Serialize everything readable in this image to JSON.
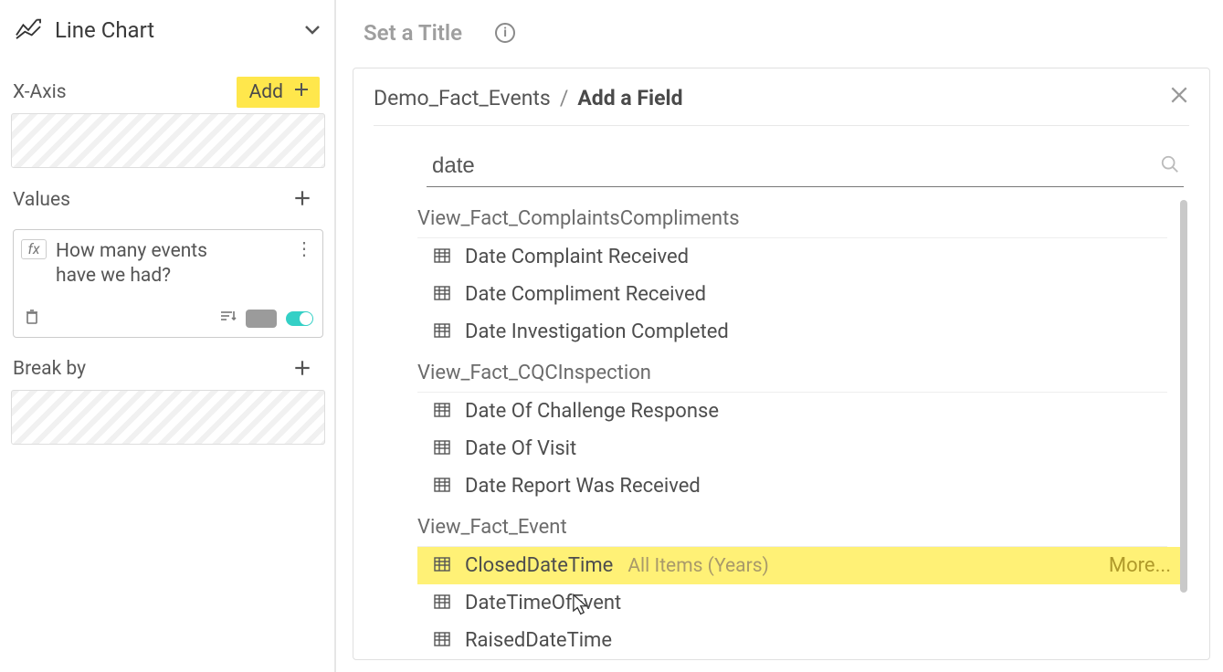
{
  "sidebar": {
    "chart_type_label": "Line Chart",
    "xaxis_title": "X-Axis",
    "xaxis_add_label": "Add",
    "values_title": "Values",
    "value_item_text": "How many events have we had?",
    "fx_label": "fx",
    "breakby_title": "Break by"
  },
  "main": {
    "title_placeholder": "Set a Title",
    "info_glyph": "i"
  },
  "panel": {
    "crumb_root": "Demo_Fact_Events",
    "crumb_leaf": "Add a Field",
    "crumb_sep": "/",
    "search_value": "date",
    "more_label": "More...",
    "groups": [
      {
        "title": "View_Fact_ComplaintsCompliments",
        "items": [
          {
            "label": "Date Complaint Received"
          },
          {
            "label": "Date Compliment Received"
          },
          {
            "label": "Date Investigation Completed"
          }
        ]
      },
      {
        "title": "View_Fact_CQCInspection",
        "items": [
          {
            "label": "Date Of Challenge Response"
          },
          {
            "label": "Date Of Visit"
          },
          {
            "label": "Date Report Was Received"
          }
        ]
      },
      {
        "title": "View_Fact_Event",
        "items": [
          {
            "label": "ClosedDateTime",
            "meta": "All Items (Years)",
            "highlight": true
          },
          {
            "label": "DateTimeOfEvent"
          },
          {
            "label": "RaisedDateTime"
          }
        ]
      }
    ]
  }
}
